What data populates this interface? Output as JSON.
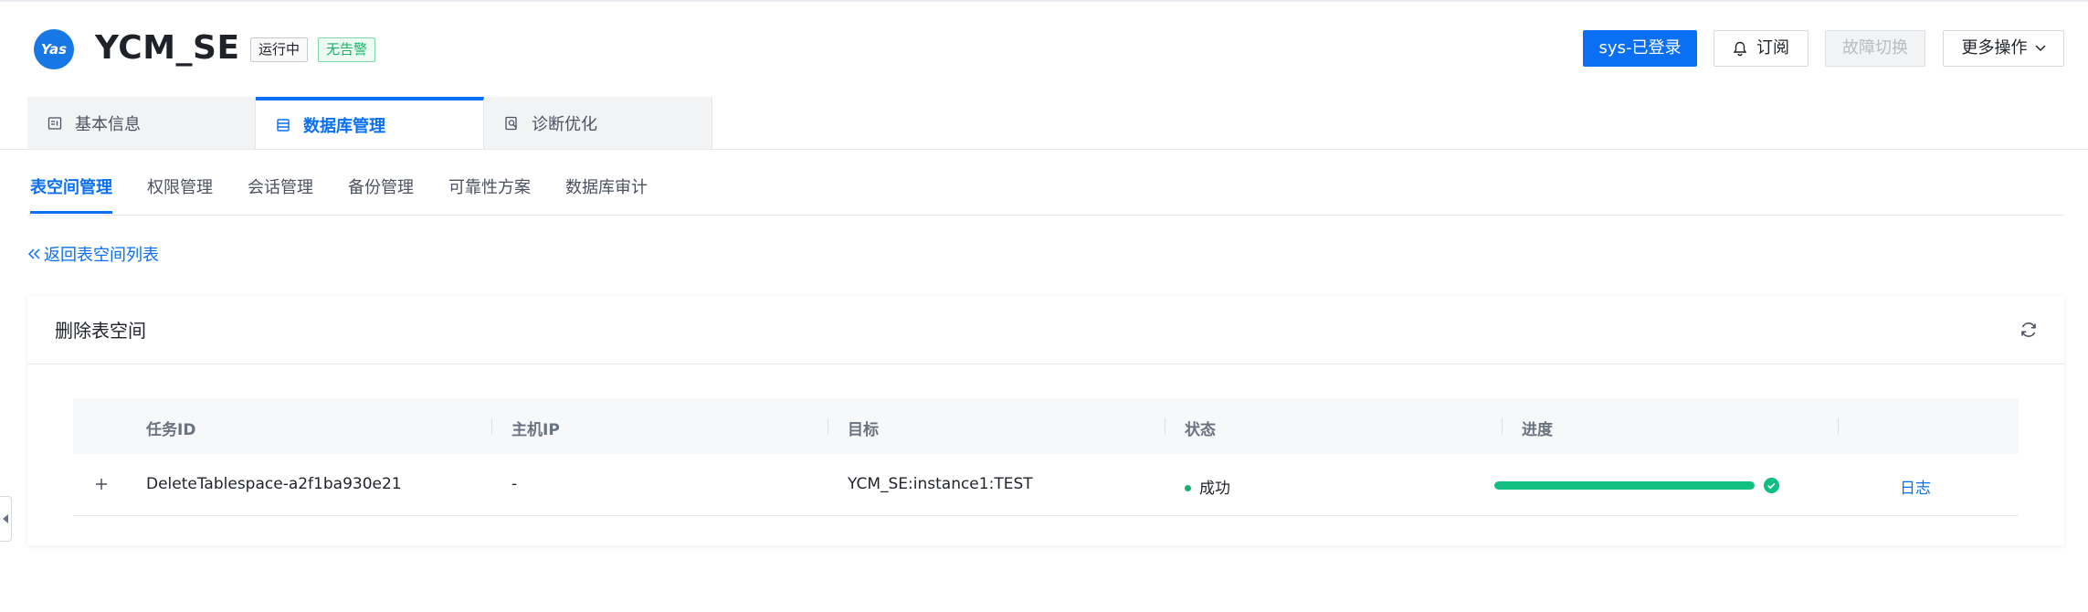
{
  "header": {
    "logo_text": "Yas",
    "instance_name": "YCM_SE",
    "status_badge": "运行中",
    "alarm_badge": "无告警",
    "login_button": "sys-已登录",
    "subscribe_button": "订阅",
    "failover_button": "故障切换",
    "more_button": "更多操作"
  },
  "main_tabs": [
    {
      "label": "基本信息",
      "icon": "info-card-icon",
      "active": false
    },
    {
      "label": "数据库管理",
      "icon": "database-icon",
      "active": true
    },
    {
      "label": "诊断优化",
      "icon": "diagnose-icon",
      "active": false
    }
  ],
  "sub_tabs": [
    {
      "label": "表空间管理",
      "active": true
    },
    {
      "label": "权限管理",
      "active": false
    },
    {
      "label": "会话管理",
      "active": false
    },
    {
      "label": "备份管理",
      "active": false
    },
    {
      "label": "可靠性方案",
      "active": false
    },
    {
      "label": "数据库审计",
      "active": false
    }
  ],
  "back_link": "返回表空间列表",
  "card": {
    "title": "删除表空间",
    "columns": [
      "任务ID",
      "主机IP",
      "目标",
      "状态",
      "进度"
    ],
    "rows": [
      {
        "task_id": "DeleteTablespace-a2f1ba930e21",
        "host_ip": "-",
        "target": "YCM_SE:instance1:TEST",
        "status": "成功",
        "progress": 1.0,
        "action": "日志"
      }
    ]
  },
  "colors": {
    "accent": "#0a6ff2",
    "success": "#17b26a",
    "progress": "#12bf83"
  }
}
